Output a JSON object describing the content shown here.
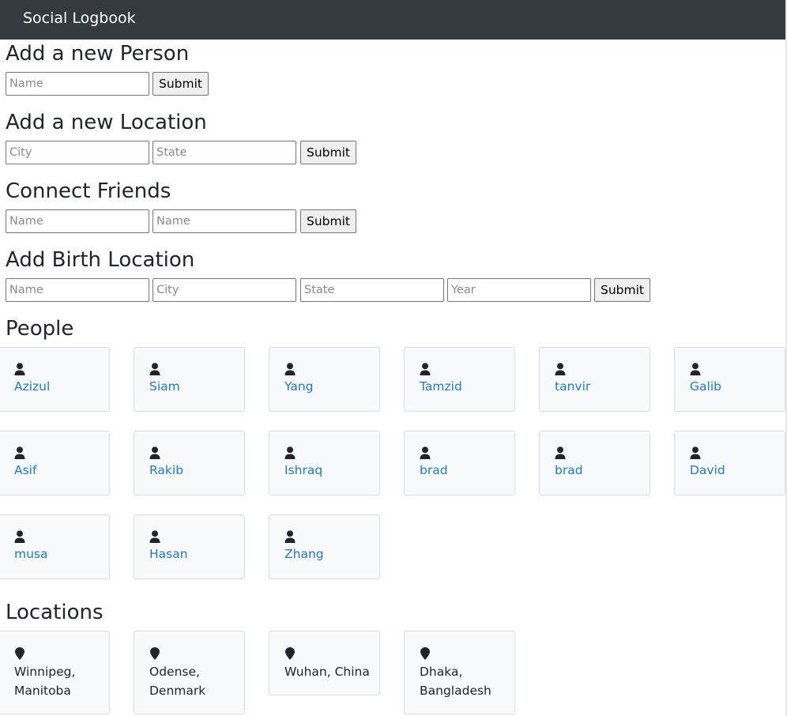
{
  "navbar": {
    "brand": "Social Logbook"
  },
  "add_person": {
    "heading": "Add a new Person",
    "name_placeholder": "Name",
    "submit_label": "Submit"
  },
  "add_location": {
    "heading": "Add a new Location",
    "city_placeholder": "City",
    "state_placeholder": "State",
    "submit_label": "Submit"
  },
  "connect_friends": {
    "heading": "Connect Friends",
    "name1_placeholder": "Name",
    "name2_placeholder": "Name",
    "submit_label": "Submit"
  },
  "birth_location": {
    "heading": "Add Birth Location",
    "name_placeholder": "Name",
    "city_placeholder": "City",
    "state_placeholder": "State",
    "year_placeholder": "Year",
    "submit_label": "Submit"
  },
  "people": {
    "heading": "People",
    "items": [
      {
        "name": "Azizul"
      },
      {
        "name": "Siam"
      },
      {
        "name": "Yang"
      },
      {
        "name": "Tamzid"
      },
      {
        "name": "tanvir"
      },
      {
        "name": "Galib"
      },
      {
        "name": "Asif"
      },
      {
        "name": "Rakib"
      },
      {
        "name": "Ishraq"
      },
      {
        "name": "brad"
      },
      {
        "name": "brad"
      },
      {
        "name": "David"
      },
      {
        "name": "musa"
      },
      {
        "name": "Hasan"
      },
      {
        "name": "Zhang"
      }
    ]
  },
  "locations": {
    "heading": "Locations",
    "items": [
      {
        "label": "Winnipeg, Manitoba"
      },
      {
        "label": "Odense, Denmark"
      },
      {
        "label": "Wuhan, China"
      },
      {
        "label": "Dhaka, Bangladesh"
      }
    ]
  },
  "icons": {
    "person": "person-icon",
    "location": "map-pin-icon"
  },
  "colors": {
    "navbar": "#343a40",
    "link": "#1b7bd3",
    "card_bg": "#f8f9fa"
  }
}
